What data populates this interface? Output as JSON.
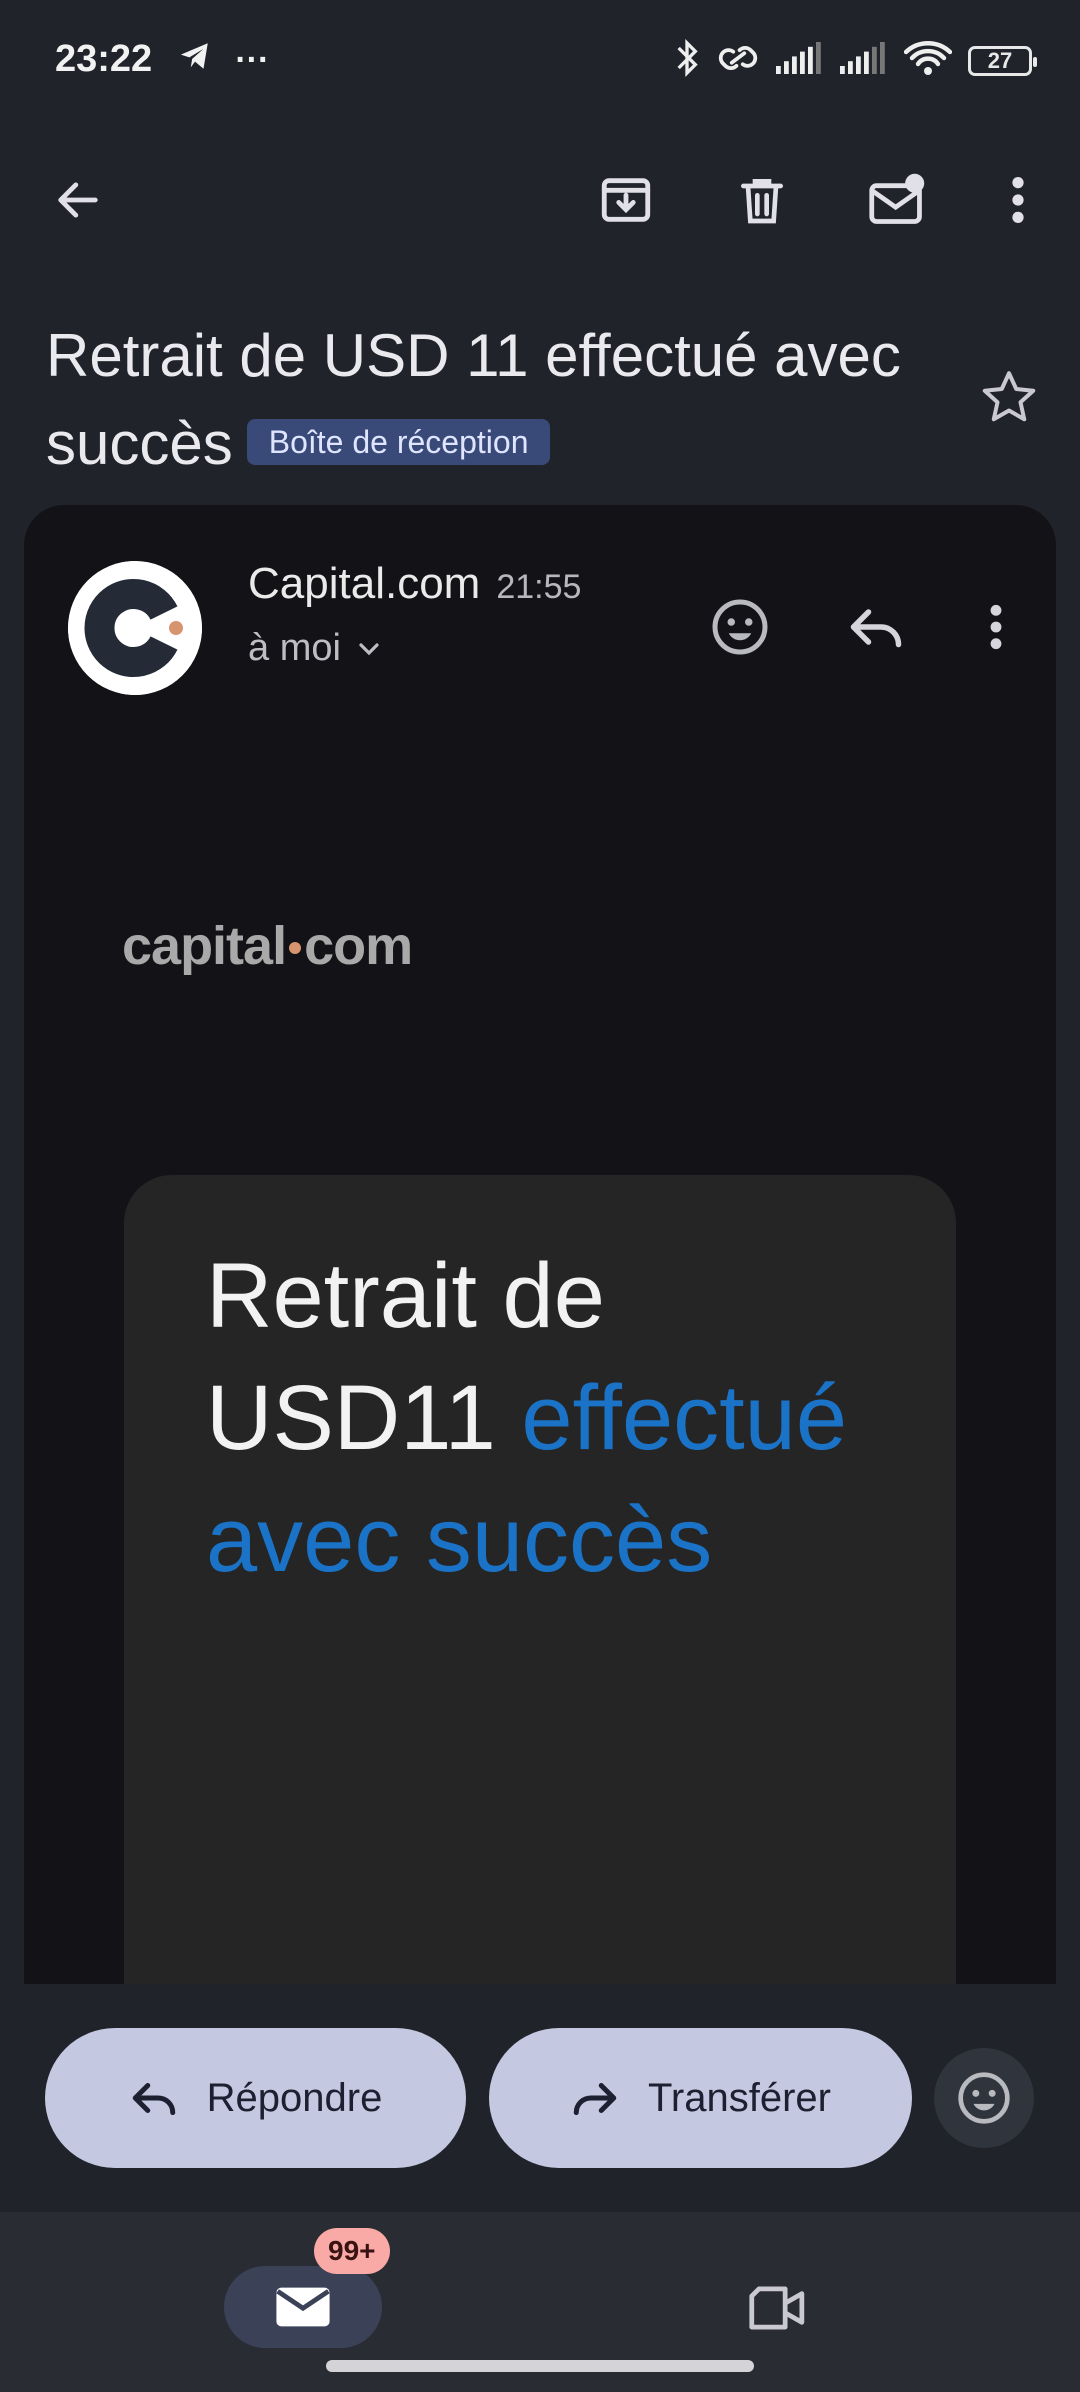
{
  "status_bar": {
    "time": "23:22",
    "more": "···",
    "battery": "27"
  },
  "email": {
    "subject": "Retrait de USD 11 effectué avec succès",
    "label": "Boîte de réception",
    "sender": "Capital.com",
    "time": "21:55",
    "recipient": "à moi"
  },
  "body": {
    "brand_left": "capital",
    "brand_right": "com",
    "headline_plain": "Retrait de USD11 ",
    "headline_accent": "effectué avec succès"
  },
  "actions": {
    "reply": "Répondre",
    "forward": "Transférer"
  },
  "nav": {
    "mail_badge": "99+"
  },
  "colors": {
    "accent_blue": "#1a73c7",
    "label_chip": "#394a78",
    "button_fill": "#c4c8e1",
    "badge": "#f9aaa6"
  }
}
